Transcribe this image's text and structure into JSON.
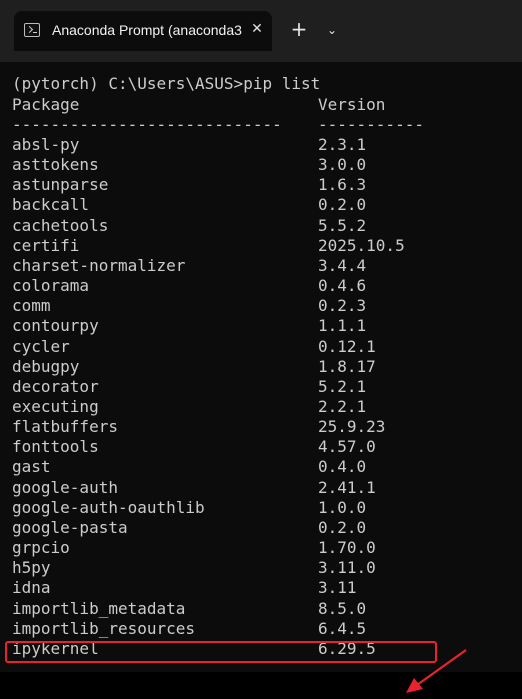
{
  "window": {
    "tab_title": "Anaconda Prompt (anaconda3",
    "close_glyph": "✕",
    "new_tab_glyph": "+",
    "dropdown_glyph": "⌄",
    "accent_color": "#e8232f"
  },
  "terminal": {
    "prompt_line": "(pytorch) C:\\Users\\ASUS>pip list",
    "header_package": "Package",
    "header_version": "Version",
    "separator_package": "----------------------------",
    "separator_version": "-----------",
    "packages": [
      {
        "name": "absl-py",
        "version": "2.3.1"
      },
      {
        "name": "asttokens",
        "version": "3.0.0"
      },
      {
        "name": "astunparse",
        "version": "1.6.3"
      },
      {
        "name": "backcall",
        "version": "0.2.0"
      },
      {
        "name": "cachetools",
        "version": "5.5.2"
      },
      {
        "name": "certifi",
        "version": "2025.10.5"
      },
      {
        "name": "charset-normalizer",
        "version": "3.4.4"
      },
      {
        "name": "colorama",
        "version": "0.4.6"
      },
      {
        "name": "comm",
        "version": "0.2.3"
      },
      {
        "name": "contourpy",
        "version": "1.1.1"
      },
      {
        "name": "cycler",
        "version": "0.12.1"
      },
      {
        "name": "debugpy",
        "version": "1.8.17"
      },
      {
        "name": "decorator",
        "version": "5.2.1"
      },
      {
        "name": "executing",
        "version": "2.2.1"
      },
      {
        "name": "flatbuffers",
        "version": "25.9.23"
      },
      {
        "name": "fonttools",
        "version": "4.57.0"
      },
      {
        "name": "gast",
        "version": "0.4.0"
      },
      {
        "name": "google-auth",
        "version": "2.41.1"
      },
      {
        "name": "google-auth-oauthlib",
        "version": "1.0.0"
      },
      {
        "name": "google-pasta",
        "version": "0.2.0"
      },
      {
        "name": "grpcio",
        "version": "1.70.0"
      },
      {
        "name": "h5py",
        "version": "3.11.0"
      },
      {
        "name": "idna",
        "version": "3.11"
      },
      {
        "name": "importlib_metadata",
        "version": "8.5.0"
      },
      {
        "name": "importlib_resources",
        "version": "6.4.5"
      },
      {
        "name": "ipykernel",
        "version": "6.29.5"
      }
    ]
  }
}
